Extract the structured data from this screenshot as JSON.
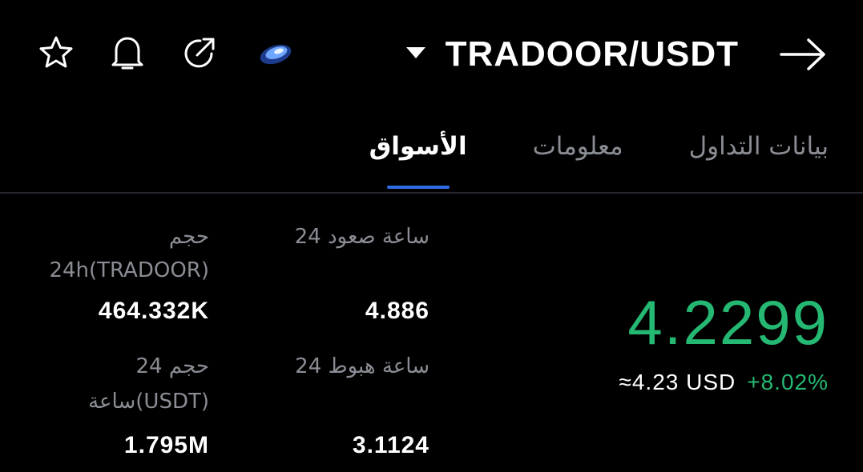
{
  "header": {
    "pair": "TRADOOR/USDT",
    "icons": [
      "star-icon",
      "bell-icon",
      "share-icon",
      "token-logo"
    ]
  },
  "tabs": [
    {
      "label": "الأسواق",
      "active": true
    },
    {
      "label": "معلومات",
      "active": false
    },
    {
      "label": "بيانات التداول",
      "active": false
    }
  ],
  "price": {
    "last": "4.2299",
    "usd": "≈4.23 USD",
    "change": "+8.02%"
  },
  "stats": {
    "high_label": "24 ساعة صعود",
    "high_value": "4.886",
    "low_label": "24 ساعة هبوط",
    "low_value": "3.1124",
    "vol_base_label_1": "حجم",
    "vol_base_label_2": "24h(TRADOOR)",
    "vol_base_value": "464.332K",
    "vol_quote_label_1": "حجم 24",
    "vol_quote_label_2": "ساعة(USDT)",
    "vol_quote_value": "1.795M"
  },
  "colors": {
    "accent": "#2f6de6",
    "up": "#25b873",
    "muted": "#8a8d94",
    "bg": "#000000"
  }
}
